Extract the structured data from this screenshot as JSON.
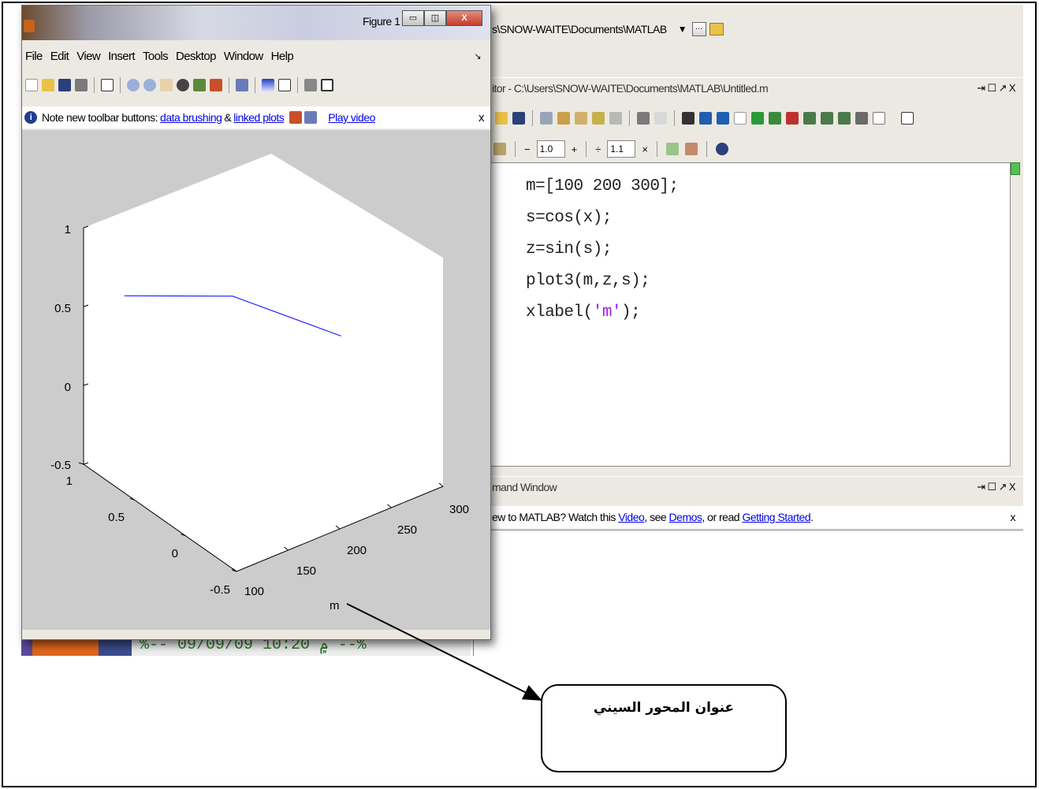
{
  "matlab": {
    "path": "s\\SNOW-WAITE\\Documents\\MATLAB",
    "editor_title": "itor - C:\\Users\\SNOW-WAITE\\Documents\\MATLAB\\Untitled.m",
    "editor_win_controls": "⇥ ☐ ↗ X",
    "zoom_minus": "−",
    "zoom_value1": "1.0",
    "zoom_plus": "+",
    "divide": "÷",
    "zoom_value2": "1.1",
    "times": "×",
    "code_lines": [
      "m=[100 200 300];",
      "s=cos(x);",
      "z=sin(s);",
      "plot3(m,z,s);"
    ],
    "code_last_prefix": "xlabel(",
    "code_last_string": "'m'",
    "code_last_suffix": ");",
    "cmd_title": "mand Window",
    "cmd_win_controls": "⇥ ☐ ↗ X",
    "cmd_info_prefix": "ew to MATLAB? Watch this",
    "cmd_info_video": "Video",
    "cmd_info_mid": ", see",
    "cmd_info_demos": "Demos",
    "cmd_info_or": ", or read",
    "cmd_info_getting": "Getting Started",
    "cmd_info_end": ".",
    "cmd_info_close": "x",
    "history_text": "%-- ۾ 10:20  09/09/09 --%"
  },
  "figure": {
    "title": "Figure 1",
    "menu": [
      "File",
      "Edit",
      "View",
      "Insert",
      "Tools",
      "Desktop",
      "Window",
      "Help"
    ],
    "note_prefix": "Note new toolbar buttons:",
    "note_link1": "data brushing",
    "note_amp": "&",
    "note_link2": "linked plots",
    "note_video": "Play video",
    "note_close": "x"
  },
  "plot_labels": {
    "z_ticks": [
      "1",
      "0.5",
      "0",
      "-0.5"
    ],
    "y_ticks": [
      "1",
      "0.5",
      "0",
      "-0.5"
    ],
    "x_ticks": [
      "100",
      "150",
      "200",
      "250",
      "300"
    ],
    "xlabel": "m"
  },
  "chart_data": {
    "type": "line",
    "series": [
      {
        "x": [
          100,
          200,
          300
        ],
        "y": [
          0.6,
          0.55,
          0.5
        ],
        "z": [
          0.75,
          0.5,
          0.0
        ],
        "color": "#0000ff"
      }
    ],
    "xlabel": "m",
    "xlim": [
      100,
      300
    ],
    "ylim": [
      -0.5,
      1
    ],
    "zlim": [
      -0.5,
      1
    ],
    "grid": false
  },
  "annotation": {
    "callout_text": "عنوان المحور السيني"
  },
  "colors": {
    "line": "#0000ff",
    "plot_bg": "#cccccc",
    "link": "#0000ee",
    "string": "#a020f0"
  }
}
